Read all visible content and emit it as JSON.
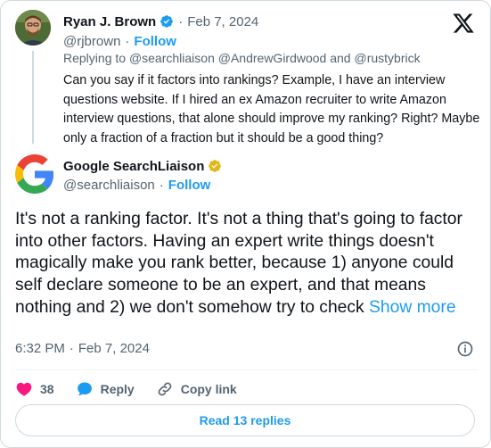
{
  "reply_tweet": {
    "author_name": "Ryan J. Brown",
    "separator": "·",
    "date": "Feb 7, 2024",
    "handle": "@rjbrown",
    "follow_label": "Follow",
    "replying_prefix": "Replying to",
    "replying_mentions": "@searchliaison @AndrewGirdwood and @rustybrick",
    "text": "Can you say if it factors into rankings? Example, I have an interview questions website. If I hired an ex Amazon recruiter to write Amazon interview questions, that alone should improve my ranking? Right? Maybe only a fraction of a fraction but it should be a good thing?"
  },
  "main_tweet": {
    "author_name": "Google SearchLiaison",
    "handle": "@searchliaison",
    "follow_label": "Follow",
    "text": "It's not a ranking factor. It's not a thing that's going to factor into other factors. Having an expert write things doesn't magically make you rank better, because 1) anyone could self declare someone to be an expert, and that means nothing and 2) we don't somehow try to check",
    "show_more_label": "Show more",
    "time": "6:32 PM",
    "date": "Feb 7, 2024"
  },
  "actions": {
    "like_count": "38",
    "reply_label": "Reply",
    "copy_link_label": "Copy link"
  },
  "read_replies_label": "Read 13 replies",
  "colors": {
    "accent": "#1d9bf0",
    "like": "#f91880",
    "verified_blue": "#1d9bf0",
    "verified_gold": "#e2b719",
    "secondary_text": "#536471"
  },
  "icons": {
    "brand": "x-logo-icon",
    "verified": "verified-badge-icon",
    "info": "info-icon",
    "like": "heart-icon",
    "reply": "speech-bubble-icon",
    "copy": "link-icon"
  }
}
